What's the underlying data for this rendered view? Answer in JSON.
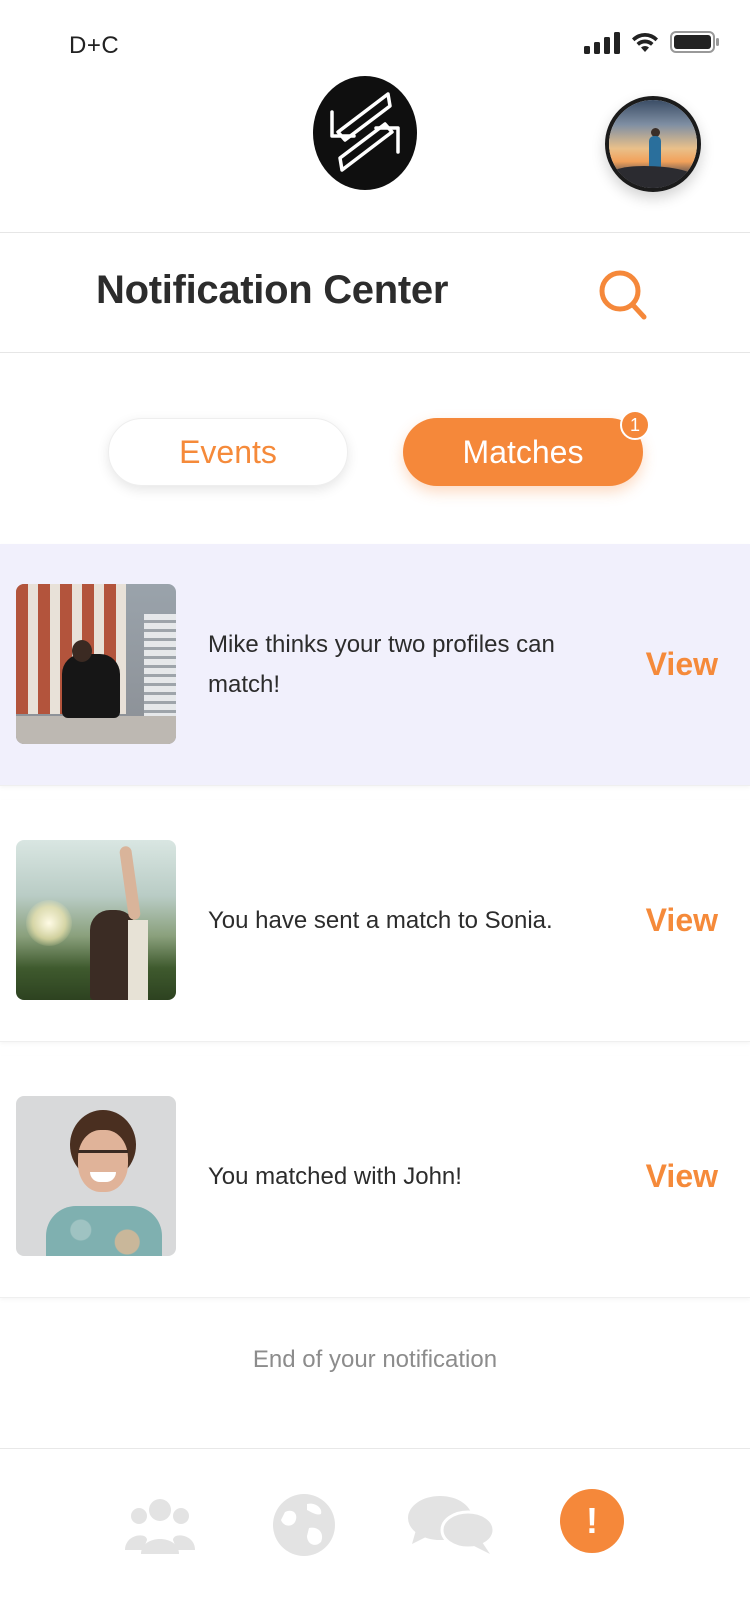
{
  "status_bar": {
    "carrier": "D+C"
  },
  "header": {
    "logo": "app-logo",
    "avatar": "profile-avatar"
  },
  "page": {
    "title": "Notification Center"
  },
  "tabs": [
    {
      "label": "Events",
      "active": false
    },
    {
      "label": "Matches",
      "active": true,
      "badge": "1"
    }
  ],
  "notifications": [
    {
      "text": "Mike thinks your two profiles can match!",
      "action": "View",
      "highlighted": true
    },
    {
      "text": "You have sent a match to Sonia.",
      "action": "View",
      "highlighted": false
    },
    {
      "text": "You matched with John!",
      "action": "View",
      "highlighted": false
    }
  ],
  "end_message": "End of your notification",
  "bottom_nav": [
    {
      "icon": "people-icon"
    },
    {
      "icon": "globe-icon"
    },
    {
      "icon": "chat-icon"
    },
    {
      "icon": "alert-icon",
      "glyph": "!",
      "active": true
    }
  ],
  "colors": {
    "accent": "#f5883a",
    "highlight_row": "#f1f0fc",
    "inactive_icon": "#e3e3e3"
  }
}
